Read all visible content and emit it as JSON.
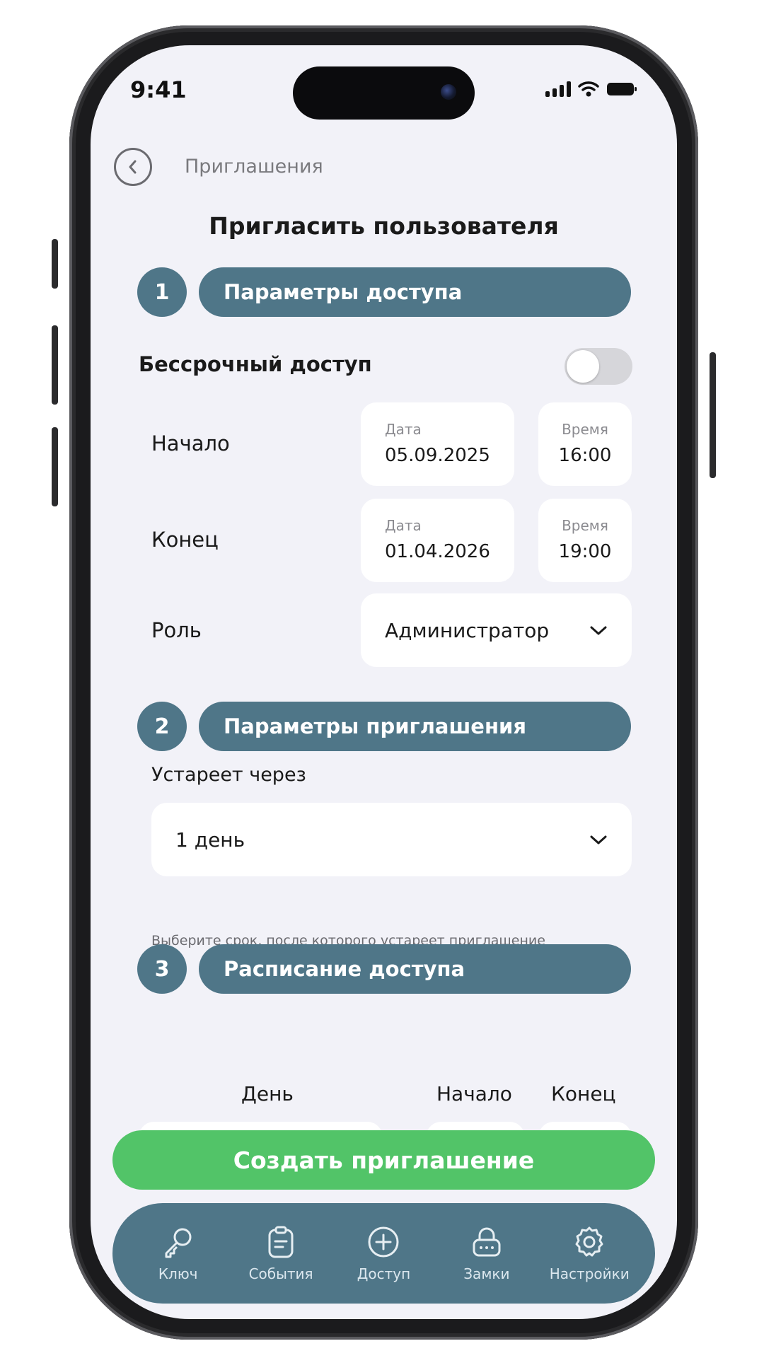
{
  "status_bar": {
    "time": "9:41"
  },
  "header": {
    "back_label": "Приглашения",
    "title": "Пригласить пользователя"
  },
  "step1": {
    "number": "1",
    "title": "Параметры доступа",
    "unlimited_label": "Бессрочный доступ",
    "unlimited_on": false,
    "start": {
      "label": "Начало",
      "date_caption": "Дата",
      "date": "05.09.2025",
      "time_caption": "Время",
      "time": "16:00"
    },
    "end": {
      "label": "Конец",
      "date_caption": "Дата",
      "date": "01.04.2026",
      "time_caption": "Время",
      "time": "19:00"
    },
    "role": {
      "label": "Роль",
      "value": "Администратор"
    }
  },
  "step2": {
    "number": "2",
    "title": "Параметры приглашения",
    "expires_label": "Устареет через",
    "expires_value": "1 день",
    "hint": "Выберите срок, после которого устареет приглашение"
  },
  "step3": {
    "number": "3",
    "title": "Расписание доступа",
    "col_day": "День",
    "col_start": "Начало",
    "col_end": "Конец"
  },
  "cta": {
    "label": "Создать приглашение"
  },
  "tabbar": {
    "items": [
      {
        "label": "Ключ",
        "icon": "key-icon"
      },
      {
        "label": "События",
        "icon": "clipboard-icon"
      },
      {
        "label": "Доступ",
        "icon": "plus-circle-icon"
      },
      {
        "label": "Замки",
        "icon": "lock-icon"
      },
      {
        "label": "Настройки",
        "icon": "gear-icon"
      }
    ]
  },
  "colors": {
    "accent": "#4f7688",
    "cta": "#52c468",
    "background": "#f2f2f8",
    "card": "#ffffff"
  }
}
